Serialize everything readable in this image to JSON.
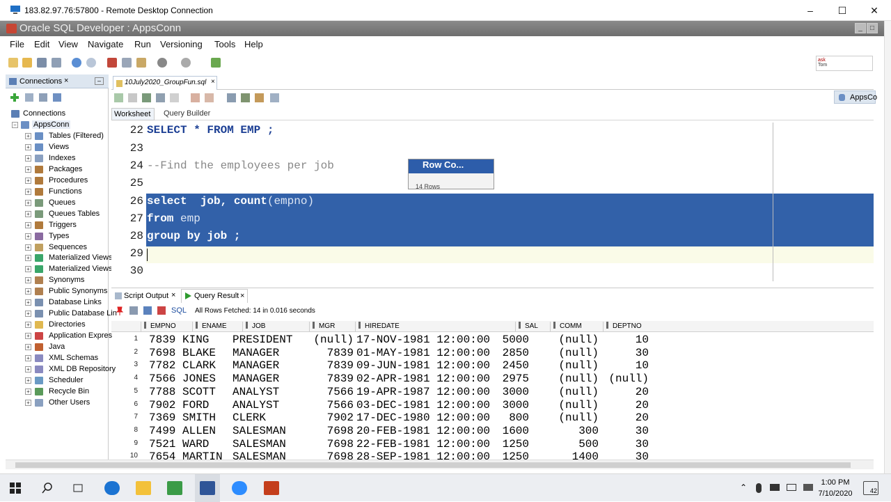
{
  "rdp": {
    "title": "183.82.97.76:57800 - Remote Desktop Connection"
  },
  "app": {
    "title": "Oracle SQL Developer : AppsConn"
  },
  "menu": [
    "File",
    "Edit",
    "View",
    "Navigate",
    "Run",
    "Versioning",
    "Tools",
    "Help"
  ],
  "ask": {
    "line1": "ask",
    "line2": "Tom"
  },
  "connections": {
    "tab_label": "Connections",
    "close": "×",
    "root": "Connections",
    "conn": "AppsConn",
    "items": [
      "Tables (Filtered)",
      "Views",
      "Indexes",
      "Packages",
      "Procedures",
      "Functions",
      "Queues",
      "Queues Tables",
      "Triggers",
      "Types",
      "Sequences",
      "Materialized Views",
      "Materialized Views",
      "Synonyms",
      "Public Synonyms",
      "Database Links",
      "Public Database Lin",
      "Directories",
      "Application Expres",
      "Java",
      "XML Schemas",
      "XML DB Repository",
      "Scheduler",
      "Recycle Bin",
      "Other Users"
    ]
  },
  "editor": {
    "file_tab": "10July2020_GroupFun.sql",
    "close": "×",
    "connection_chip": "AppsCo",
    "tab_worksheet": "Worksheet",
    "tab_query_builder": "Query Builder",
    "lines": [
      {
        "n": "22",
        "code": "SELECT * FROM EMP ;"
      },
      {
        "n": "23",
        "code": ""
      },
      {
        "n": "24",
        "code": "--Find the employees per job"
      },
      {
        "n": "25",
        "code": ""
      },
      {
        "n": "26",
        "code": "select  job, count(empno)"
      },
      {
        "n": "27",
        "code": "from emp"
      },
      {
        "n": "28",
        "code": "group by job ;"
      },
      {
        "n": "29",
        "code": ""
      },
      {
        "n": "30",
        "code": ""
      }
    ],
    "tokens": {
      "l22a": "SELECT",
      "l22b": " * ",
      "l22c": "FROM",
      "l22d": " EMP ;",
      "l24": "--Find the employees per job",
      "l26a": "select",
      "l26b": "  job, ",
      "l26c": "count",
      "l26d": "(empno)",
      "l27a": "from",
      "l27b": " emp",
      "l28a": "group by",
      "l28b": " job ;"
    },
    "popup_title": "Row Co...",
    "popup_sub": "14 Rows"
  },
  "results": {
    "tab_script_output": "Script Output",
    "tab_query_result": "Query Result",
    "close": "×",
    "sql_label": "SQL",
    "status": "All Rows Fetched: 14 in 0.016 seconds",
    "columns": [
      "EMPNO",
      "ENAME",
      "JOB",
      "MGR",
      "HIREDATE",
      "SAL",
      "COMM",
      "DEPTNO"
    ],
    "rows": [
      [
        "1",
        "7839",
        "KING",
        "PRESIDENT",
        "(null)",
        "17-NOV-1981 12:00:00",
        "5000",
        "(null)",
        "10"
      ],
      [
        "2",
        "7698",
        "BLAKE",
        "MANAGER",
        "7839",
        "01-MAY-1981 12:00:00",
        "2850",
        "(null)",
        "30"
      ],
      [
        "3",
        "7782",
        "CLARK",
        "MANAGER",
        "7839",
        "09-JUN-1981 12:00:00",
        "2450",
        "(null)",
        "10"
      ],
      [
        "4",
        "7566",
        "JONES",
        "MANAGER",
        "7839",
        "02-APR-1981 12:00:00",
        "2975",
        "(null)",
        "(null)"
      ],
      [
        "5",
        "7788",
        "SCOTT",
        "ANALYST",
        "7566",
        "19-APR-1987 12:00:00",
        "3000",
        "(null)",
        "20"
      ],
      [
        "6",
        "7902",
        "FORD",
        "ANALYST",
        "7566",
        "03-DEC-1981 12:00:00",
        "3000",
        "(null)",
        "20"
      ],
      [
        "7",
        "7369",
        "SMITH",
        "CLERK",
        "7902",
        "17-DEC-1980 12:00:00",
        "800",
        "(null)",
        "20"
      ],
      [
        "8",
        "7499",
        "ALLEN",
        "SALESMAN",
        "7698",
        "20-FEB-1981 12:00:00",
        "1600",
        "300",
        "30"
      ],
      [
        "9",
        "7521",
        "WARD",
        "SALESMAN",
        "7698",
        "22-FEB-1981 12:00:00",
        "1250",
        "500",
        "30"
      ],
      [
        "10",
        "7654",
        "MARTIN",
        "SALESMAN",
        "7698",
        "28-SEP-1981 12:00:00",
        "1250",
        "1400",
        "30"
      ]
    ]
  },
  "taskbar": {
    "time": "1:00 PM",
    "date": "7/10/2020",
    "notifications": "42"
  },
  "colors": {
    "selection": "#3261a9",
    "keyword": "#1c3f94",
    "comment": "#888888",
    "title_bar": "#7a7a7a"
  }
}
